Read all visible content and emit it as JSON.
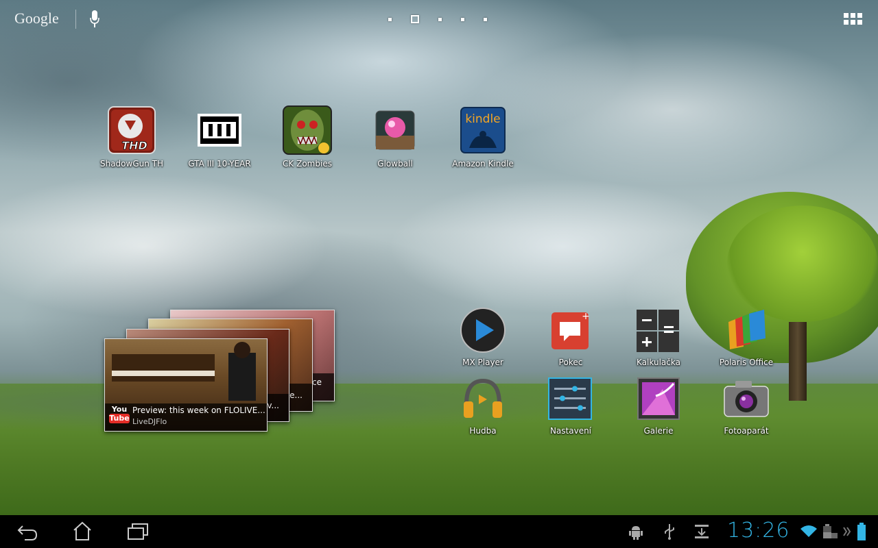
{
  "search": {
    "logo_text": "Google"
  },
  "pages": {
    "count": 5,
    "current_index": 1
  },
  "desktop_apps": [
    {
      "label": "ShadowGun TH",
      "icon": "shadowgun-icon"
    },
    {
      "label": "GTA III 10-YEAR",
      "icon": "gta3-icon"
    },
    {
      "label": "CK Zombies",
      "icon": "zombies-icon"
    },
    {
      "label": "Glowball",
      "icon": "glowball-icon"
    },
    {
      "label": "Amazon Kindle",
      "icon": "kindle-icon",
      "icon_text": "kindle"
    }
  ],
  "dock_apps": [
    {
      "label": "MX Player",
      "icon": "mx-player-icon"
    },
    {
      "label": "Pokec",
      "icon": "pokec-icon"
    },
    {
      "label": "Kalkulačka",
      "icon": "calculator-icon"
    },
    {
      "label": "Polaris Office",
      "icon": "polaris-office-icon"
    },
    {
      "label": "Hudba",
      "icon": "music-headphones-icon"
    },
    {
      "label": "Nastavení",
      "icon": "settings-icon"
    },
    {
      "label": "Galerie",
      "icon": "gallery-icon"
    },
    {
      "label": "Fotoaparát",
      "icon": "camera-icon"
    }
  ],
  "youtube_widget": {
    "logo_you": "You",
    "logo_tube": "Tube",
    "video_title": "Preview: this week on FLOLIVE...",
    "channel": "LiveDJFlo",
    "back_card_1_text": "ov...",
    "back_card_2_text": "ke...",
    "back_card_3_text": "ce"
  },
  "status_bar": {
    "time": "13:26",
    "icons": [
      "android-debug-icon",
      "usb-icon",
      "download-icon",
      "wifi-icon",
      "keyboard-battery-icon",
      "battery-icon"
    ]
  },
  "colors": {
    "clock": "#33b5e5",
    "navbar": "#000000",
    "youtube_red": "#e52d27"
  }
}
